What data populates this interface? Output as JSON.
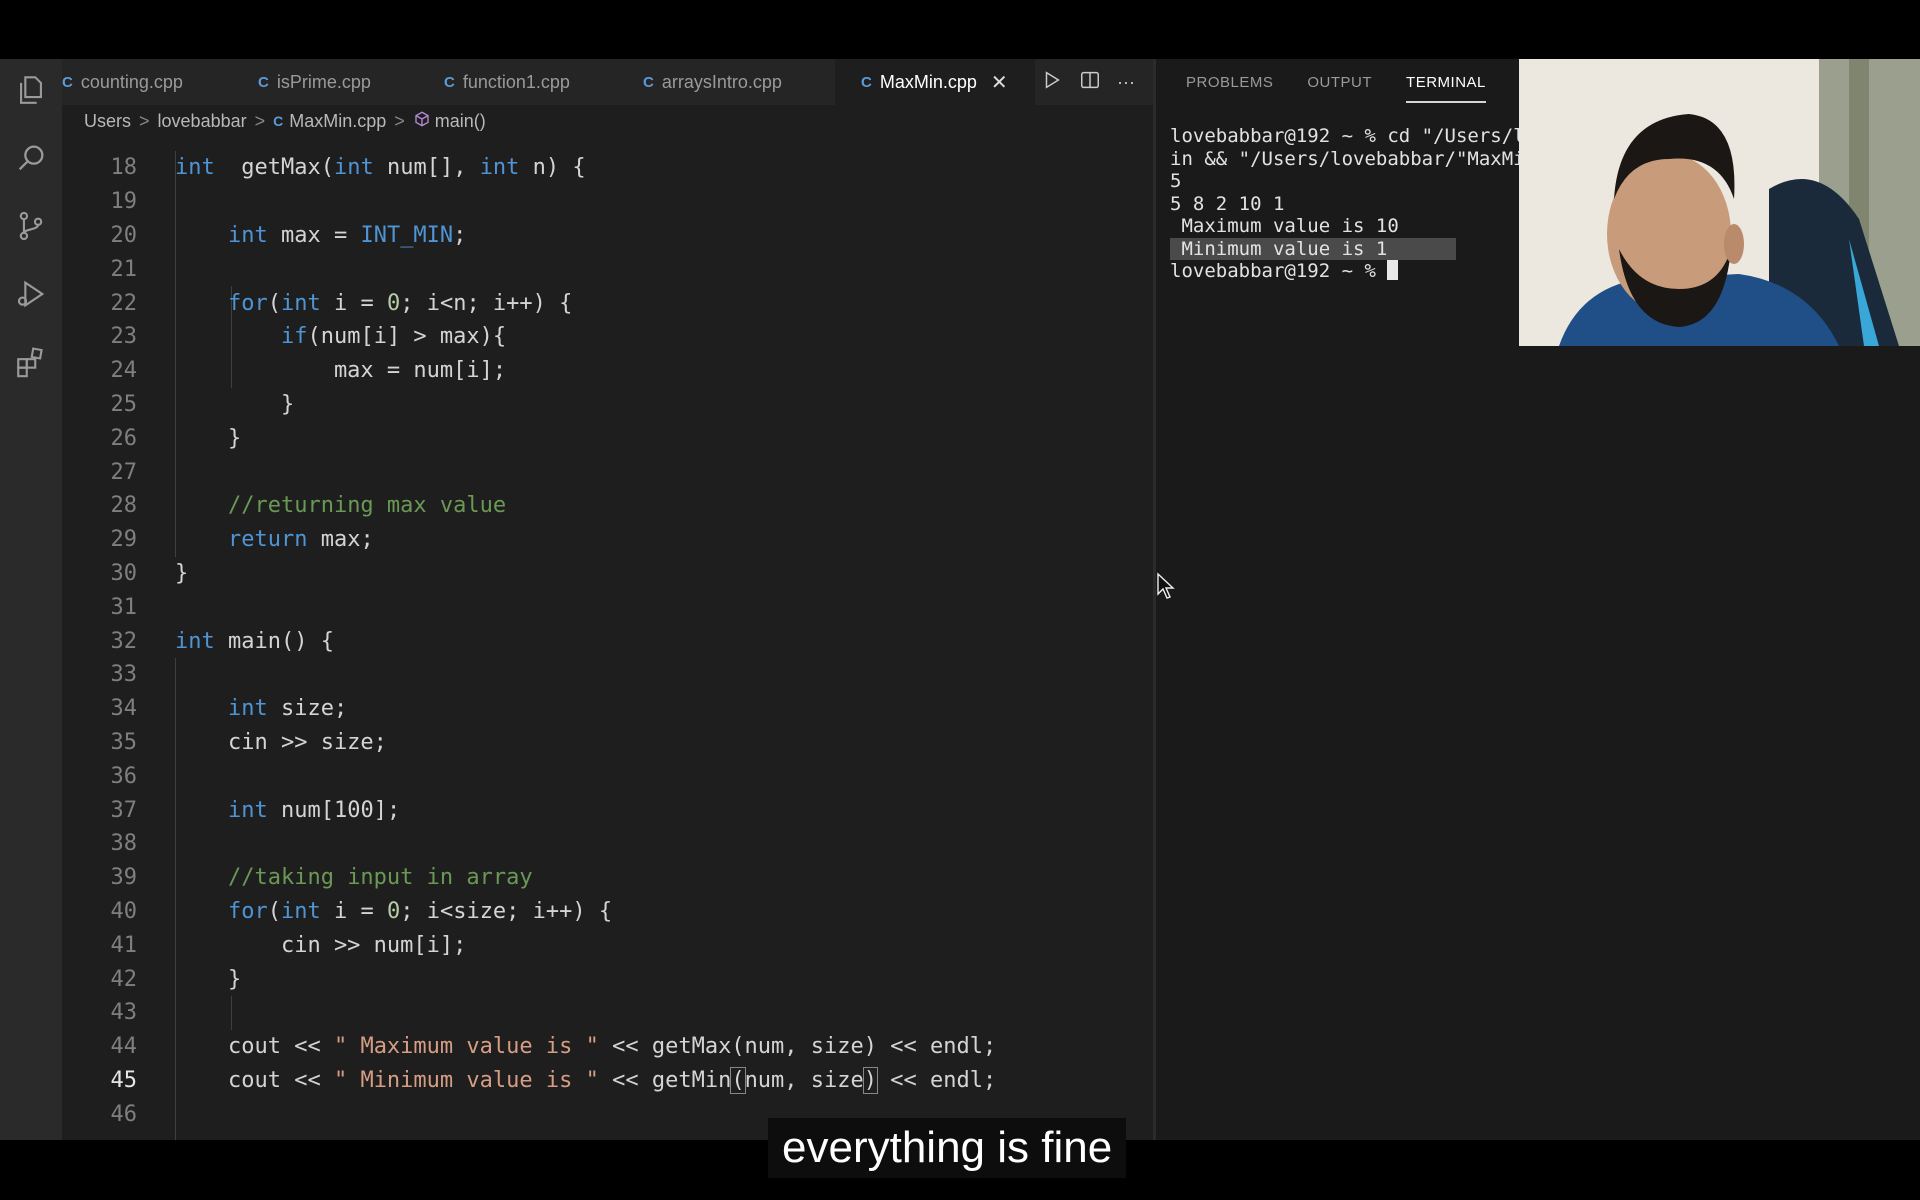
{
  "tabs": [
    {
      "label": "counting.cpp",
      "icon": "cpp-file-icon",
      "active": false
    },
    {
      "label": "isPrime.cpp",
      "icon": "cpp-file-icon",
      "active": false
    },
    {
      "label": "function1.cpp",
      "icon": "cpp-file-icon",
      "active": false
    },
    {
      "label": "arraysIntro.cpp",
      "icon": "cpp-file-icon",
      "active": false
    },
    {
      "label": "MaxMin.cpp",
      "icon": "cpp-file-icon",
      "active": true
    }
  ],
  "file_icon_glyph": "C",
  "close_glyph": "✕",
  "more_glyph": "···",
  "breadcrumb": {
    "items": [
      "Users",
      "lovebabbar",
      "MaxMin.cpp",
      "main()"
    ],
    "sep": ">"
  },
  "code": [
    {
      "n": "18",
      "t": [
        [
          "kw",
          "int"
        ],
        [
          "",
          "  getMax("
        ],
        [
          "kw",
          "int"
        ],
        [
          "",
          " num[], "
        ],
        [
          "kw",
          "int"
        ],
        [
          "",
          " n) {"
        ]
      ]
    },
    {
      "n": "19",
      "t": []
    },
    {
      "n": "20",
      "t": [
        [
          "",
          "    "
        ],
        [
          "kw",
          "int"
        ],
        [
          "",
          " max = "
        ],
        [
          "mac",
          "INT_MIN"
        ],
        [
          "",
          ";"
        ]
      ]
    },
    {
      "n": "21",
      "t": []
    },
    {
      "n": "22",
      "t": [
        [
          "",
          "    "
        ],
        [
          "ctl",
          "for"
        ],
        [
          "",
          "("
        ],
        [
          "kw",
          "int"
        ],
        [
          "",
          " i = "
        ],
        [
          "num",
          "0"
        ],
        [
          "",
          "; i<n; i++) {"
        ]
      ]
    },
    {
      "n": "23",
      "t": [
        [
          "",
          "        "
        ],
        [
          "ctl",
          "if"
        ],
        [
          "",
          "(num[i] > max){"
        ]
      ]
    },
    {
      "n": "24",
      "t": [
        [
          "",
          "            max = num[i];"
        ]
      ]
    },
    {
      "n": "25",
      "t": [
        [
          "",
          "        }"
        ]
      ]
    },
    {
      "n": "26",
      "t": [
        [
          "",
          "    }"
        ]
      ]
    },
    {
      "n": "27",
      "t": []
    },
    {
      "n": "28",
      "t": [
        [
          "",
          "    "
        ],
        [
          "cm",
          "//returning max value"
        ]
      ]
    },
    {
      "n": "29",
      "t": [
        [
          "",
          "    "
        ],
        [
          "ctl",
          "return"
        ],
        [
          "",
          " max;"
        ]
      ]
    },
    {
      "n": "30",
      "t": [
        [
          "",
          "}"
        ]
      ]
    },
    {
      "n": "31",
      "t": []
    },
    {
      "n": "32",
      "t": [
        [
          "kw",
          "int"
        ],
        [
          "",
          " main() {"
        ]
      ]
    },
    {
      "n": "33",
      "t": []
    },
    {
      "n": "34",
      "t": [
        [
          "",
          "    "
        ],
        [
          "kw",
          "int"
        ],
        [
          "",
          " size;"
        ]
      ]
    },
    {
      "n": "35",
      "t": [
        [
          "",
          "    cin >> size;"
        ]
      ]
    },
    {
      "n": "36",
      "t": []
    },
    {
      "n": "37",
      "t": [
        [
          "",
          "    "
        ],
        [
          "kw",
          "int"
        ],
        [
          "",
          " num[100];"
        ]
      ]
    },
    {
      "n": "38",
      "t": []
    },
    {
      "n": "39",
      "t": [
        [
          "",
          "    "
        ],
        [
          "cm",
          "//taking input in array"
        ]
      ]
    },
    {
      "n": "40",
      "t": [
        [
          "",
          "    "
        ],
        [
          "ctl",
          "for"
        ],
        [
          "",
          "("
        ],
        [
          "kw",
          "int"
        ],
        [
          "",
          " i = "
        ],
        [
          "num",
          "0"
        ],
        [
          "",
          "; i<size; i++) {"
        ]
      ]
    },
    {
      "n": "41",
      "t": [
        [
          "",
          "        cin >> num[i];"
        ]
      ]
    },
    {
      "n": "42",
      "t": [
        [
          "",
          "    }"
        ]
      ]
    },
    {
      "n": "43",
      "t": []
    },
    {
      "n": "44",
      "t": [
        [
          "",
          "    cout << "
        ],
        [
          "str",
          "\" Maximum value is \""
        ],
        [
          "",
          " << getMax(num, size) << endl;"
        ]
      ]
    },
    {
      "n": "45",
      "t": [
        [
          "",
          "    cout << "
        ],
        [
          "str",
          "\" Minimum value is \""
        ],
        [
          "",
          " << getMin"
        ],
        [
          "bracket",
          "("
        ],
        [
          "",
          "num, size"
        ],
        [
          "bracket",
          ")"
        ],
        [
          "",
          " << endl;"
        ]
      ],
      "current": true
    },
    {
      "n": "46",
      "t": []
    }
  ],
  "panel_tabs": [
    "PROBLEMS",
    "OUTPUT",
    "TERMINAL"
  ],
  "terminal": [
    {
      "text": "lovebabbar@192 ~ % cd \"/Users/l",
      "hl": false
    },
    {
      "text": "in && \"/Users/lovebabbar/\"MaxMi",
      "hl": false
    },
    {
      "text": "5",
      "hl": false
    },
    {
      "text": "5 8 2 10 1",
      "hl": false
    },
    {
      "text": " Maximum value is 10",
      "hl": false
    },
    {
      "text": " Minimum value is 1      ",
      "hl": true
    },
    {
      "text": "lovebabbar@192 ~ % ",
      "hl": false,
      "cursor": true
    }
  ],
  "caption": "everything is fine",
  "colors": {
    "keyword": "#4f94d4",
    "comment": "#6a9955",
    "string": "#d69d85",
    "editor_bg": "#1e1e1e"
  }
}
